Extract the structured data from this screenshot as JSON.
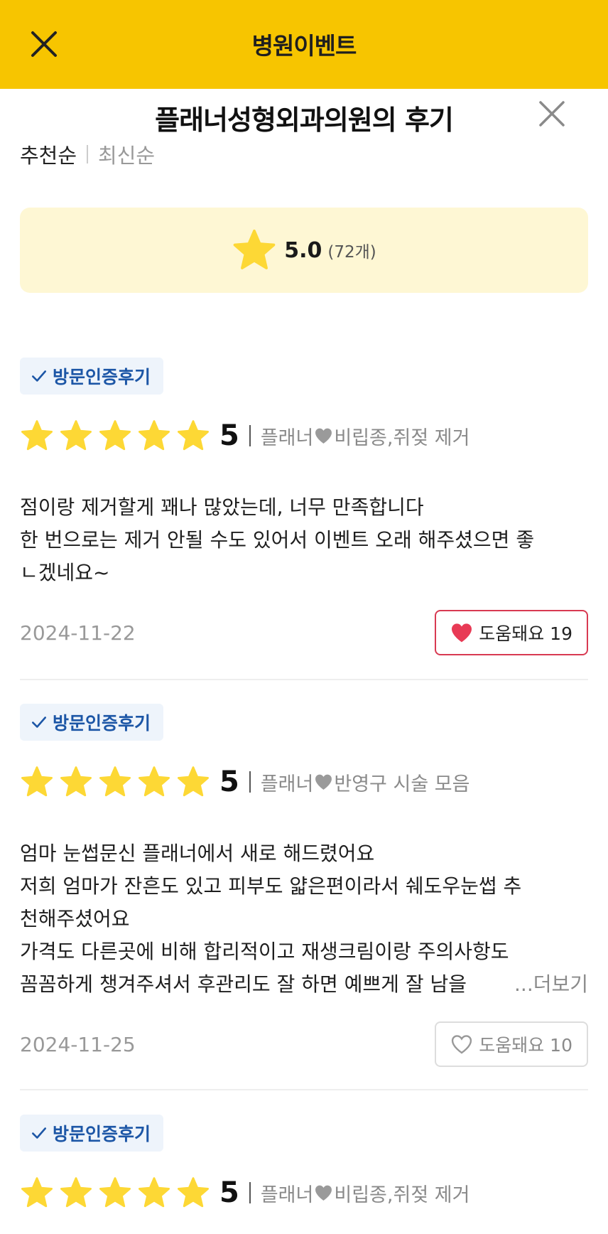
{
  "appbar": {
    "title": "병원이벤트",
    "close_icon": "close-icon"
  },
  "sheet": {
    "title": "플래너성형외과의원의 후기",
    "close_icon": "close-icon"
  },
  "sort": {
    "options": [
      "추천순",
      "최신순"
    ],
    "selected": "추천순"
  },
  "summary": {
    "score": "5.0",
    "count": "(72개)",
    "star_color": "#fdd835"
  },
  "colors": {
    "brand_yellow": "#f7c500",
    "badge_blue": "#1c56a6",
    "heart_red": "#e83a55"
  },
  "reviews": [
    {
      "badge": "방문인증후기",
      "stars": 5,
      "rating": "5",
      "product_left": "플래너",
      "product_right": "비립종,쥐젖 제거",
      "body": [
        "점이랑 제거할게 꽤나 많았는데, 너무 만족합니다",
        "한 번으로는 제거 안될 수도 있어서 이벤트 오래 해주셨으면 좋",
        "ㄴ겠네요~"
      ],
      "date": "2024-11-22",
      "helpful_label": "도움돼요 19",
      "helpful_active": true
    },
    {
      "badge": "방문인증후기",
      "stars": 5,
      "rating": "5",
      "product_left": "플래너",
      "product_right": "반영구 시술 모음",
      "body": [
        "엄마 눈썹문신 플래너에서 새로 해드렸어요",
        "저희 엄마가 잔흔도 있고 피부도 얇은편이라서 쉐도우눈썹 추",
        "천해주셨어요",
        "가격도 다른곳에 비해 합리적이고 재생크림이랑 주의사항도",
        "꼼꼼하게 챙겨주셔서 후관리도 잘 하면 예쁘게 잘 남을"
      ],
      "more_label": "...더보기",
      "date": "2024-11-25",
      "helpful_label": "도움돼요 10",
      "helpful_active": false
    },
    {
      "badge": "방문인증후기",
      "stars": 5,
      "rating": "5",
      "product_left": "플래너",
      "product_right": "비립종,쥐젖 제거"
    }
  ]
}
